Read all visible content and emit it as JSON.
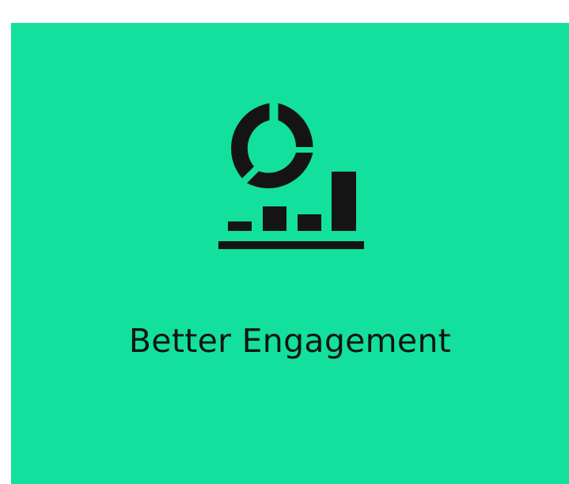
{
  "colors": {
    "page_background": "#ffffff",
    "card_background": "#13e09c",
    "ink": "#141414"
  },
  "card": {
    "icon": "engagement-analytics-icon",
    "title": "Better Engagement"
  }
}
